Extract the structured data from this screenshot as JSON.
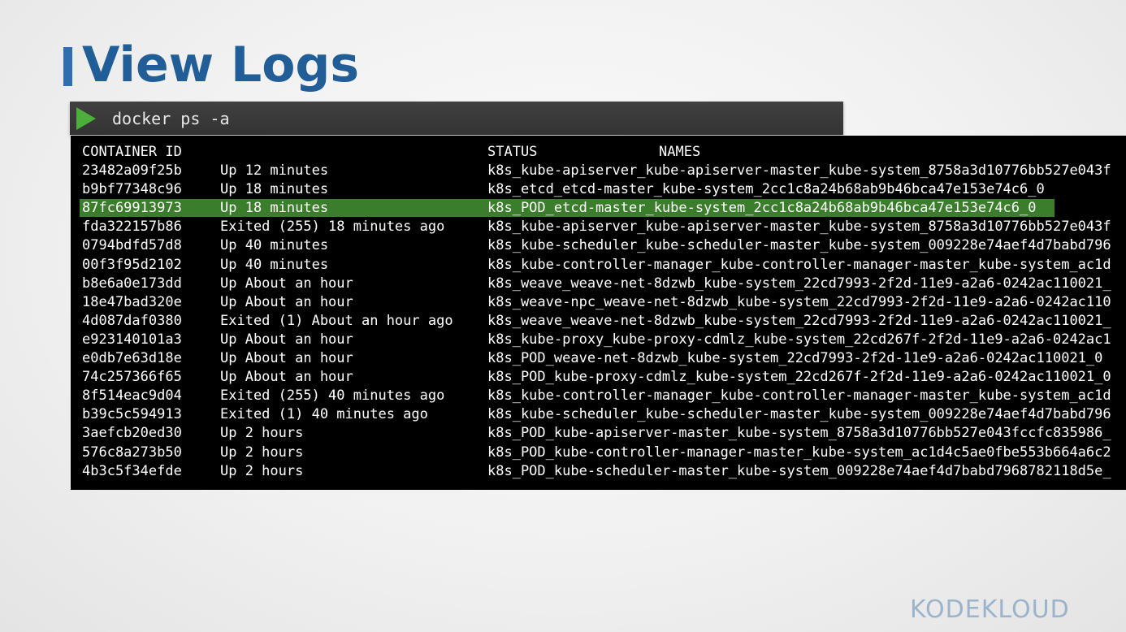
{
  "slide": {
    "title": "View Logs"
  },
  "command": {
    "text": "docker ps -a"
  },
  "table": {
    "headers": {
      "container_id": "CONTAINER ID",
      "status": "STATUS",
      "names": "NAMES"
    },
    "rows": [
      {
        "id": "23482a09f25b",
        "status": "Up 12 minutes",
        "names": "k8s_kube-apiserver_kube-apiserver-master_kube-system_8758a3d10776bb527e043f",
        "highlighted": false
      },
      {
        "id": "b9bf77348c96",
        "status": "Up 18 minutes",
        "names": "k8s_etcd_etcd-master_kube-system_2cc1c8a24b68ab9b46bca47e153e74c6_0",
        "highlighted": false
      },
      {
        "id": "87fc69913973",
        "status": "Up 18 minutes",
        "names": "k8s_POD_etcd-master_kube-system_2cc1c8a24b68ab9b46bca47e153e74c6_0",
        "highlighted": true
      },
      {
        "id": "fda322157b86",
        "status": "Exited (255) 18 minutes ago",
        "names": "k8s_kube-apiserver_kube-apiserver-master_kube-system_8758a3d10776bb527e043f",
        "highlighted": false
      },
      {
        "id": "0794bdfd57d8",
        "status": "Up 40 minutes",
        "names": "k8s_kube-scheduler_kube-scheduler-master_kube-system_009228e74aef4d7babd796",
        "highlighted": false
      },
      {
        "id": "00f3f95d2102",
        "status": "Up 40 minutes",
        "names": "k8s_kube-controller-manager_kube-controller-manager-master_kube-system_ac1d",
        "highlighted": false
      },
      {
        "id": "b8e6a0e173dd",
        "status": "Up About an hour",
        "names": "k8s_weave_weave-net-8dzwb_kube-system_22cd7993-2f2d-11e9-a2a6-0242ac110021_",
        "highlighted": false
      },
      {
        "id": "18e47bad320e",
        "status": "Up About an hour",
        "names": "k8s_weave-npc_weave-net-8dzwb_kube-system_22cd7993-2f2d-11e9-a2a6-0242ac110",
        "highlighted": false
      },
      {
        "id": "4d087daf0380",
        "status": "Exited (1) About an hour ago",
        "names": "k8s_weave_weave-net-8dzwb_kube-system_22cd7993-2f2d-11e9-a2a6-0242ac110021_",
        "highlighted": false
      },
      {
        "id": "e923140101a3",
        "status": "Up About an hour",
        "names": "k8s_kube-proxy_kube-proxy-cdmlz_kube-system_22cd267f-2f2d-11e9-a2a6-0242ac1",
        "highlighted": false
      },
      {
        "id": "e0db7e63d18e",
        "status": "Up About an hour",
        "names": "k8s_POD_weave-net-8dzwb_kube-system_22cd7993-2f2d-11e9-a2a6-0242ac110021_0",
        "highlighted": false
      },
      {
        "id": "74c257366f65",
        "status": "Up About an hour",
        "names": "k8s_POD_kube-proxy-cdmlz_kube-system_22cd267f-2f2d-11e9-a2a6-0242ac110021_0",
        "highlighted": false
      },
      {
        "id": "8f514eac9d04",
        "status": "Exited (255) 40 minutes ago",
        "names": "k8s_kube-controller-manager_kube-controller-manager-master_kube-system_ac1d",
        "highlighted": false
      },
      {
        "id": "b39c5c594913",
        "status": "Exited (1) 40 minutes ago",
        "names": "k8s_kube-scheduler_kube-scheduler-master_kube-system_009228e74aef4d7babd796",
        "highlighted": false
      },
      {
        "id": "3aefcb20ed30",
        "status": "Up 2 hours",
        "names": "k8s_POD_kube-apiserver-master_kube-system_8758a3d10776bb527e043fccfc835986_",
        "highlighted": false
      },
      {
        "id": "576c8a273b50",
        "status": "Up 2 hours",
        "names": "k8s_POD_kube-controller-manager-master_kube-system_ac1d4c5ae0fbe553b664a6c2",
        "highlighted": false
      },
      {
        "id": "4b3c5f34efde",
        "status": "Up 2 hours",
        "names": "k8s_POD_kube-scheduler-master_kube-system_009228e74aef4d7babd7968782118d5e_",
        "highlighted": false
      }
    ]
  },
  "branding": {
    "logo": "KODEKLOUD"
  },
  "colors": {
    "title": "#215d96",
    "accent_bar": "#2f6fb0",
    "highlight": "#3a7d2a",
    "play_icon": "#4caf3c",
    "terminal_bg": "#000000"
  },
  "icons": {
    "prompt": "play-icon"
  }
}
